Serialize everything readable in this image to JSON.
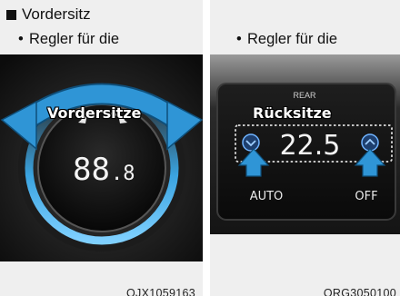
{
  "left": {
    "heading": "Vordersitz",
    "bullet_marker": "•",
    "bullet_line1": "Regler für die",
    "bullet_line2": "Vordersitze",
    "display_value": "88",
    "display_decimal": ".8",
    "figure_code": "OJX1059163"
  },
  "right": {
    "bullet_marker": "•",
    "bullet_line1": "Regler für die",
    "bullet_line2": "Rücksitze",
    "panel_label": "REAR",
    "temperature": "22.5",
    "auto_label": "AUTO",
    "off_label": "OFF",
    "figure_code": "ORG3050100"
  },
  "colors": {
    "panel_bg": "#efefef",
    "arrow_blue": "#2f95d6",
    "knob_ring": "#3aa3e0"
  }
}
